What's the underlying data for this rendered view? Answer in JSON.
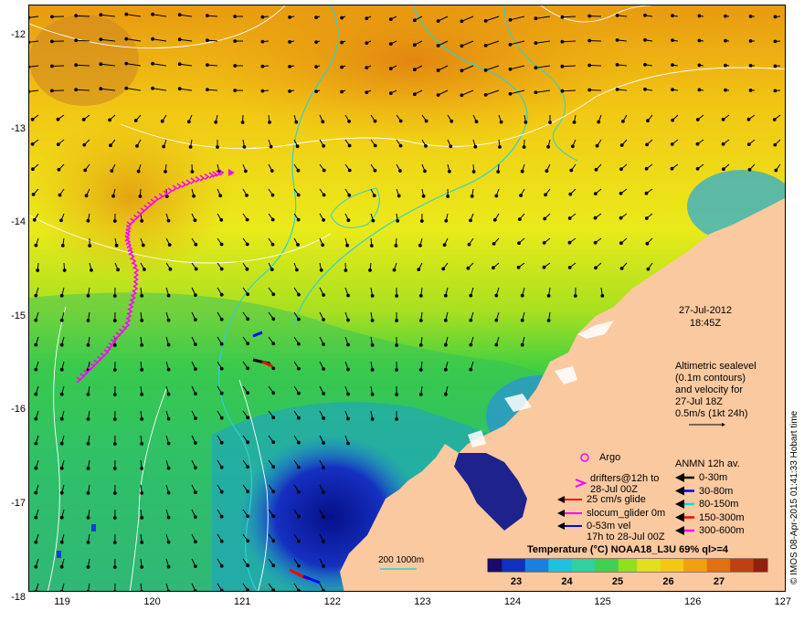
{
  "map": {
    "lon_ticks": [
      "119",
      "120",
      "121",
      "122",
      "123",
      "124",
      "125",
      "126",
      "127"
    ],
    "lat_ticks": [
      "-12",
      "-13",
      "-14",
      "-15",
      "-16",
      "-17",
      "-18"
    ],
    "date": "27-Jul-2012",
    "time": "18:45Z",
    "altimetry_lines": [
      "Altimetric sealevel",
      "(0.1m contours)",
      "and velocity for",
      "27-Jul 18Z",
      "0.5m/s (1kt 24h)"
    ],
    "argo_label": "Argo",
    "drifters_label": [
      "drifters@12h to",
      "28-Jul 00Z"
    ],
    "glider_labels": [
      "25 cm/s glide",
      "slocum_glider 0m"
    ],
    "vel_labels": [
      "0-53m vel",
      "17h to 28-Jul 00Z"
    ],
    "anmn_title": "ANMN 12h av.",
    "anmn_depths": [
      "0-30m",
      "30-80m",
      "80-150m",
      "150-300m",
      "300-600m"
    ],
    "anmn_colors": [
      "#000000",
      "#0000ff",
      "#00e0e0",
      "#ff0000",
      "#ff00ff"
    ],
    "bathy_label": "200  1000m",
    "colorbar_title": "Temperature (°C) NOAA18_L3U 69% ql>=4",
    "colorbar_ticks": [
      "23",
      "24",
      "25",
      "26",
      "27"
    ],
    "credit": "© IMOS 08-Apr-2015 01:41:33 Hobart time",
    "colors": {
      "land": "#fbc9a0",
      "drifter": "#ff00ff",
      "contour_cyan": "#30d0d0",
      "contour_white": "#ffffff"
    }
  }
}
